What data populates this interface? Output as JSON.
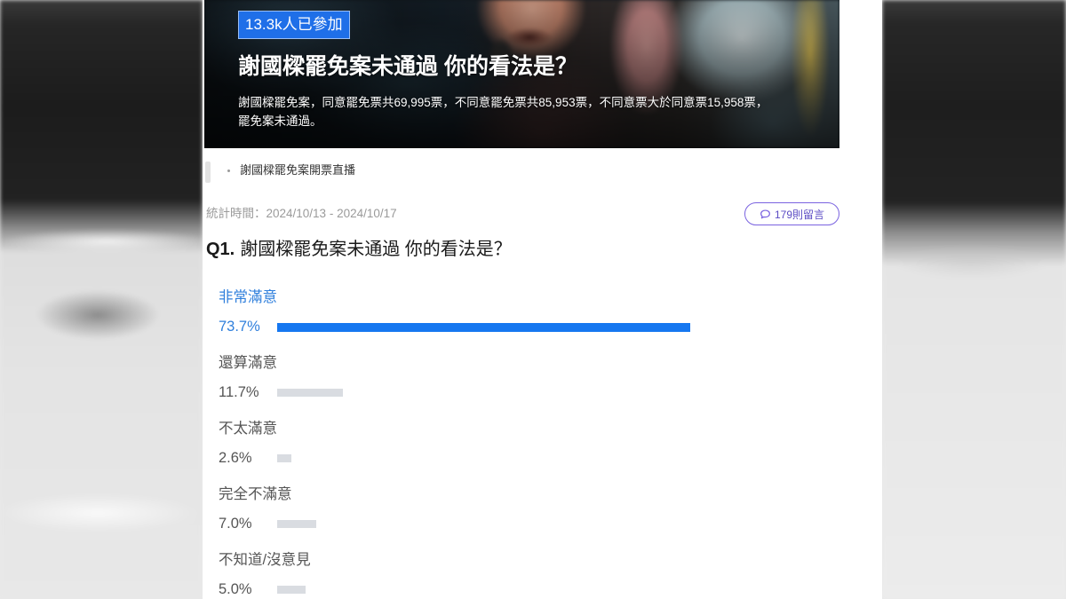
{
  "poll": {
    "participants_badge": "13.3k人已參加",
    "title": "謝國樑罷免案未通過 你的看法是？",
    "description_lines": [
      "謝國樑罷免案，同意罷免票共69,995票，不同意罷免票共85,953票，不同意票大於同意票15,958票，",
      "罷免案未通過。"
    ],
    "related_link": "謝國樑罷免案開票直播",
    "stats_period": "統計時間：2024/10/13 - 2024/10/17",
    "comments_button": "179則留言",
    "question": {
      "number": "Q1.",
      "text": "謝國樑罷免案未通過 你的看法是？",
      "options": [
        {
          "label": "非常滿意",
          "percent_text": "73.7%",
          "percent": 73.7,
          "highlighted": true
        },
        {
          "label": "還算滿意",
          "percent_text": "11.7%",
          "percent": 11.7,
          "highlighted": false
        },
        {
          "label": "不太滿意",
          "percent_text": "2.6%",
          "percent": 2.6,
          "highlighted": false
        },
        {
          "label": "完全不滿意",
          "percent_text": "7.0%",
          "percent": 7.0,
          "highlighted": false
        },
        {
          "label": "不知道/沒意見",
          "percent_text": "5.0%",
          "percent": 5.0,
          "highlighted": false
        }
      ]
    }
  },
  "icons": {
    "comments": "speech-bubble-icon",
    "related_link_bullet": "bullet-dot-icon"
  },
  "colors": {
    "badge": "#1f6fe8",
    "accent_text": "#2f7fdc",
    "accent_bar": "#1677f0",
    "bar_inactive": "#d9dce1",
    "comment_button": "#7a63e0"
  }
}
